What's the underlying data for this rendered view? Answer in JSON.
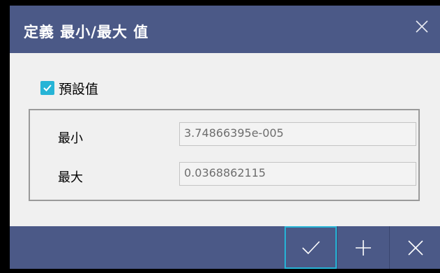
{
  "dialog": {
    "title": "定義 最小/最大 值",
    "close_icon": "close-icon",
    "default_checkbox": {
      "label": "預設值",
      "checked": true
    },
    "fields": {
      "min": {
        "label": "最小",
        "value": "3.74866395e-005"
      },
      "max": {
        "label": "最大",
        "value": "0.0368862115"
      }
    },
    "footer": {
      "ok_icon": "checkmark-icon",
      "add_icon": "plus-icon",
      "cancel_icon": "close-icon"
    },
    "colors": {
      "titlebar": "#4b5987",
      "accent": "#26b4d6",
      "body": "#f0f0f0"
    }
  }
}
